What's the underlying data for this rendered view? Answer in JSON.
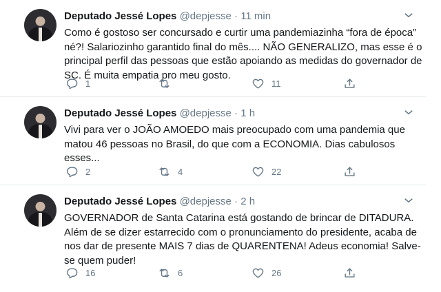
{
  "tweets": [
    {
      "name": "Deputado Jessé Lopes",
      "handle": "@depjesse",
      "time": "11 min",
      "text": "Como é gostoso ser concursado e curtir uma pandemiazinha “fora de época” né?! Salariozinho garantido final do mês.... NÃO GENERALIZO, mas esse é o principal perfil das pessoas que estão apoiando as medidas do governador de SC. É muita empatia pro meu gosto.",
      "replies": "1",
      "retweets": "",
      "likes": "11"
    },
    {
      "name": "Deputado Jessé Lopes",
      "handle": "@depjesse",
      "time": "1 h",
      "text": "Vivi para ver o JOÃO AMOEDO mais preocupado com uma pandemia que matou 46 pessoas no Brasil, do que com a ECONOMIA. Dias cabulosos esses...",
      "replies": "2",
      "retweets": "4",
      "likes": "22"
    },
    {
      "name": "Deputado Jessé Lopes",
      "handle": "@depjesse",
      "time": "2 h",
      "text": "GOVERNADOR de Santa Catarina está gostando de brincar de DITADURA. Além de se dizer estarrecido com o pronunciamento do presidente, acaba de nos dar de presente MAIS 7 dias de QUARENTENA! Adeus economia! Salve-se quem puder!",
      "replies": "16",
      "retweets": "6",
      "likes": "26"
    }
  ],
  "separator": "·",
  "icons": [
    "reply-icon",
    "retweet-icon",
    "like-icon",
    "share-icon",
    "chevron-down-icon"
  ]
}
